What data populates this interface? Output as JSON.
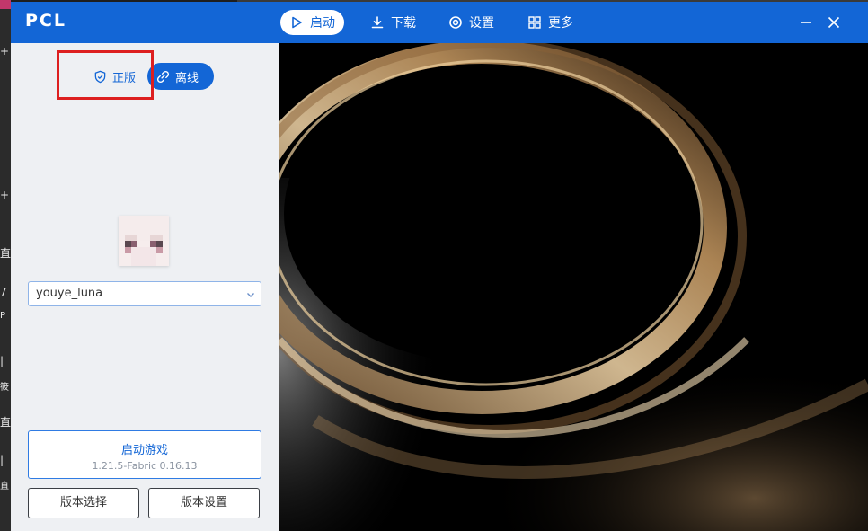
{
  "window": {
    "title": "PCL"
  },
  "nav": [
    {
      "label": "启动",
      "icon": "play-icon",
      "active": true
    },
    {
      "label": "下载",
      "icon": "download-icon",
      "active": false
    },
    {
      "label": "设置",
      "icon": "settings-icon",
      "active": false
    },
    {
      "label": "更多",
      "icon": "grid-icon",
      "active": false
    }
  ],
  "account": {
    "legit_label": "正版",
    "offline_label": "离线",
    "username": "youye_luna"
  },
  "launch": {
    "label": "启动游戏",
    "version": "1.21.5-Fabric 0.16.13"
  },
  "buttons": {
    "version_select": "版本选择",
    "version_settings": "版本设置"
  },
  "desktop": {
    "glyphs": [
      "+",
      "+",
      "直",
      "7",
      "P",
      "|",
      "筱",
      "直",
      "|",
      "直"
    ]
  },
  "colors": {
    "accent": "#1366d6",
    "highlight_box": "#dd1f1f"
  }
}
